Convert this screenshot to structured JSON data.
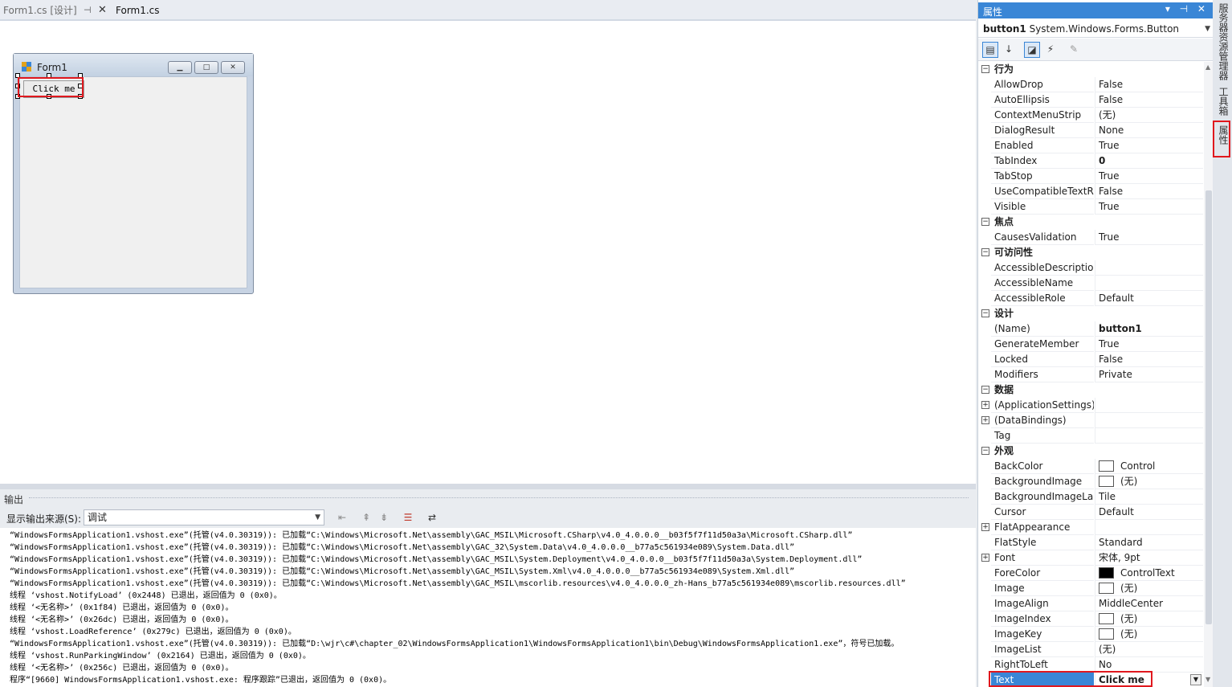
{
  "tabs": {
    "design": "Form1.cs [设计]",
    "design_pin": "⊣",
    "design_close": "✕",
    "code": "Form1.cs"
  },
  "designer": {
    "form_title": "Form1",
    "button_text": "Click me"
  },
  "output": {
    "title": "输出",
    "source_label": "显示输出来源(S):",
    "source_value": "调试",
    "lines": [
      "“WindowsFormsApplication1.vshost.exe”(托管(v4.0.30319)): 已加载“C:\\Windows\\Microsoft.Net\\assembly\\GAC_MSIL\\Microsoft.CSharp\\v4.0_4.0.0.0__b03f5f7f11d50a3a\\Microsoft.CSharp.dll”",
      "“WindowsFormsApplication1.vshost.exe”(托管(v4.0.30319)): 已加载“C:\\Windows\\Microsoft.Net\\assembly\\GAC_32\\System.Data\\v4.0_4.0.0.0__b77a5c561934e089\\System.Data.dll”",
      "“WindowsFormsApplication1.vshost.exe”(托管(v4.0.30319)): 已加载“C:\\Windows\\Microsoft.Net\\assembly\\GAC_MSIL\\System.Deployment\\v4.0_4.0.0.0__b03f5f7f11d50a3a\\System.Deployment.dll”",
      "“WindowsFormsApplication1.vshost.exe”(托管(v4.0.30319)): 已加载“C:\\Windows\\Microsoft.Net\\assembly\\GAC_MSIL\\System.Xml\\v4.0_4.0.0.0__b77a5c561934e089\\System.Xml.dll”",
      "“WindowsFormsApplication1.vshost.exe”(托管(v4.0.30319)): 已加载“C:\\Windows\\Microsoft.Net\\assembly\\GAC_MSIL\\mscorlib.resources\\v4.0_4.0.0.0_zh-Hans_b77a5c561934e089\\mscorlib.resources.dll”",
      "线程 ‘vshost.NotifyLoad’ (0x2448) 已退出，返回值为 0 (0x0)。",
      "线程 ‘<无名称>’ (0x1f84) 已退出，返回值为 0 (0x0)。",
      "线程 ‘<无名称>’ (0x26dc) 已退出，返回值为 0 (0x0)。",
      "线程 ‘vshost.LoadReference’ (0x279c) 已退出，返回值为 0 (0x0)。",
      "“WindowsFormsApplication1.vshost.exe”(托管(v4.0.30319)): 已加载“D:\\wjr\\c#\\chapter_02\\WindowsFormsApplication1\\WindowsFormsApplication1\\bin\\Debug\\WindowsFormsApplication1.exe”，符号已加载。",
      "线程 ‘vshost.RunParkingWindow’ (0x2164) 已退出，返回值为 0 (0x0)。",
      "线程 ‘<无名称>’ (0x256c) 已退出，返回值为 0 (0x0)。",
      "程序“[9660] WindowsFormsApplication1.vshost.exe: 程序跟踪”已退出，返回值为 0 (0x0)。"
    ]
  },
  "properties": {
    "title": "属性",
    "title_buttons": "▾ ⊣ ✕",
    "object_name": "button1",
    "object_type": "System.Windows.Forms.Button",
    "rows": [
      {
        "kind": "cat",
        "label": "行为"
      },
      {
        "kind": "prop",
        "name": "AllowDrop",
        "value": "False"
      },
      {
        "kind": "prop",
        "name": "AutoEllipsis",
        "value": "False"
      },
      {
        "kind": "prop",
        "name": "ContextMenuStrip",
        "value": "(无)"
      },
      {
        "kind": "prop",
        "name": "DialogResult",
        "value": "None"
      },
      {
        "kind": "prop",
        "name": "Enabled",
        "value": "True"
      },
      {
        "kind": "prop",
        "name": "TabIndex",
        "value": "0",
        "bold": true
      },
      {
        "kind": "prop",
        "name": "TabStop",
        "value": "True"
      },
      {
        "kind": "prop",
        "name": "UseCompatibleTextRe",
        "value": "False"
      },
      {
        "kind": "prop",
        "name": "Visible",
        "value": "True"
      },
      {
        "kind": "cat",
        "label": "焦点"
      },
      {
        "kind": "prop",
        "name": "CausesValidation",
        "value": "True"
      },
      {
        "kind": "cat",
        "label": "可访问性"
      },
      {
        "kind": "prop",
        "name": "AccessibleDescription",
        "value": ""
      },
      {
        "kind": "prop",
        "name": "AccessibleName",
        "value": ""
      },
      {
        "kind": "prop",
        "name": "AccessibleRole",
        "value": "Default"
      },
      {
        "kind": "cat",
        "label": "设计"
      },
      {
        "kind": "prop",
        "name": "(Name)",
        "value": "button1",
        "bold": true
      },
      {
        "kind": "prop",
        "name": "GenerateMember",
        "value": "True"
      },
      {
        "kind": "prop",
        "name": "Locked",
        "value": "False"
      },
      {
        "kind": "prop",
        "name": "Modifiers",
        "value": "Private"
      },
      {
        "kind": "cat",
        "label": "数据"
      },
      {
        "kind": "prop",
        "name": "(ApplicationSettings)",
        "value": "",
        "expandable": true
      },
      {
        "kind": "prop",
        "name": "(DataBindings)",
        "value": "",
        "expandable": true
      },
      {
        "kind": "prop",
        "name": "Tag",
        "value": ""
      },
      {
        "kind": "cat",
        "label": "外观"
      },
      {
        "kind": "prop",
        "name": "BackColor",
        "value": "Control",
        "swatch": "white"
      },
      {
        "kind": "prop",
        "name": "BackgroundImage",
        "value": "(无)",
        "swatch": "white"
      },
      {
        "kind": "prop",
        "name": "BackgroundImageLa",
        "value": "Tile"
      },
      {
        "kind": "prop",
        "name": "Cursor",
        "value": "Default"
      },
      {
        "kind": "prop",
        "name": "FlatAppearance",
        "value": "",
        "expandable": true
      },
      {
        "kind": "prop",
        "name": "FlatStyle",
        "value": "Standard"
      },
      {
        "kind": "prop",
        "name": "Font",
        "value": "宋体, 9pt",
        "expandable": true
      },
      {
        "kind": "prop",
        "name": "ForeColor",
        "value": "ControlText",
        "swatch": "black"
      },
      {
        "kind": "prop",
        "name": "Image",
        "value": "(无)",
        "swatch": "white"
      },
      {
        "kind": "prop",
        "name": "ImageAlign",
        "value": "MiddleCenter"
      },
      {
        "kind": "prop",
        "name": "ImageIndex",
        "value": "(无)",
        "swatch": "white"
      },
      {
        "kind": "prop",
        "name": "ImageKey",
        "value": "(无)",
        "swatch": "white"
      },
      {
        "kind": "prop",
        "name": "ImageList",
        "value": "(无)"
      },
      {
        "kind": "prop",
        "name": "RightToLeft",
        "value": "No"
      },
      {
        "kind": "prop",
        "name": "Text",
        "value": "Click me",
        "selected": true,
        "dropdown": true
      }
    ]
  },
  "side_tabs": [
    "服务器资源管理器",
    "工具箱",
    "属性"
  ],
  "colors": {
    "accent": "#3a86d6",
    "highlight_red": "#e0181e"
  }
}
